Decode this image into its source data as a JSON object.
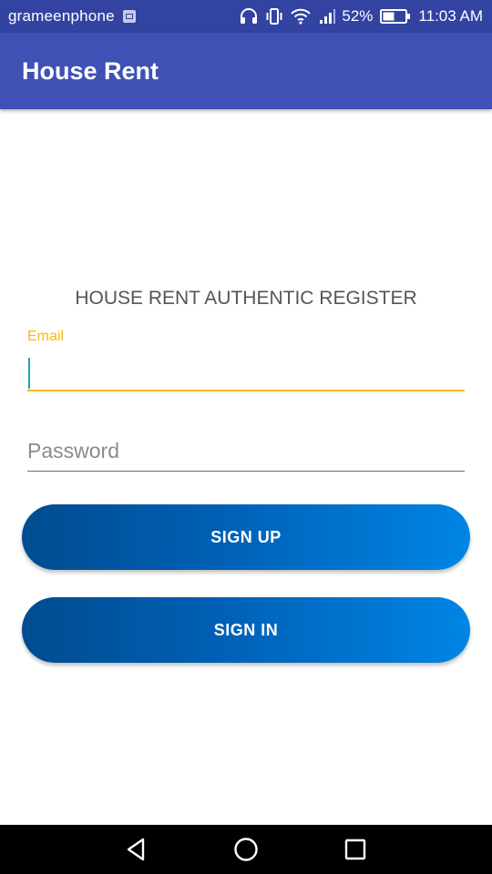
{
  "status_bar": {
    "carrier": "grameenphone",
    "battery_percent": "52%",
    "time": "11:03 AM",
    "icons": [
      "gallery-icon",
      "headphones-icon",
      "vibrate-icon",
      "wifi-icon",
      "signal-icon",
      "battery-icon"
    ]
  },
  "app_bar": {
    "title": "House Rent"
  },
  "form": {
    "heading": "HOUSE RENT AUTHENTIC REGISTER",
    "email_label": "Email",
    "email_value": "",
    "password_placeholder": "Password",
    "password_value": ""
  },
  "buttons": {
    "sign_up": "SIGN UP",
    "sign_in": "SIGN IN"
  },
  "nav": {
    "icons": [
      "back-icon",
      "home-icon",
      "recent-apps-icon"
    ]
  },
  "colors": {
    "status_bar": "#3343a2",
    "app_bar": "#3f51b5",
    "accent": "#f4bc0f",
    "button_start": "#004c8f",
    "button_end": "#0085e4"
  }
}
